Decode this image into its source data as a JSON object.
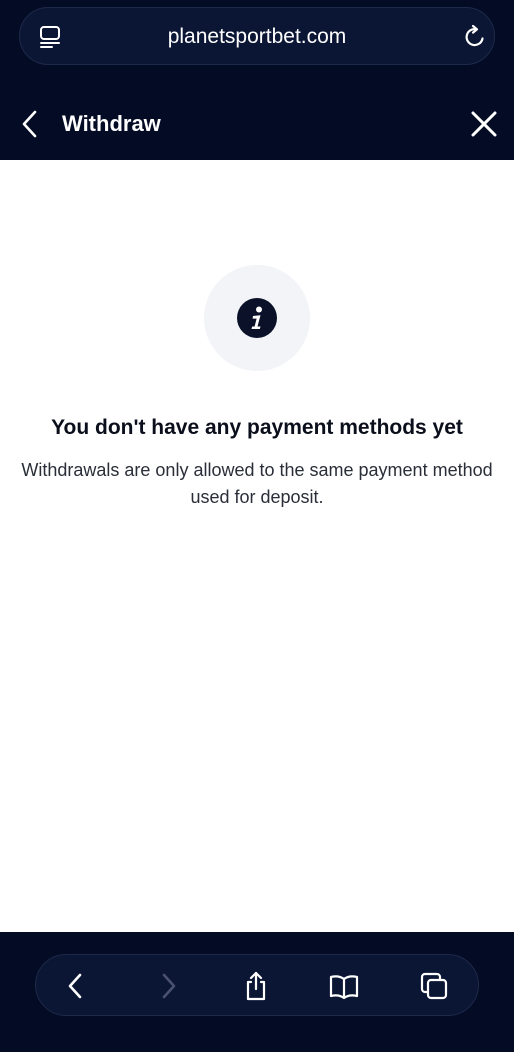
{
  "browser": {
    "url": "planetsportbet.com"
  },
  "header": {
    "title": "Withdraw"
  },
  "empty_state": {
    "title": "You don't have any payment methods yet",
    "description": "Withdrawals are only allowed to the same payment method used for deposit."
  },
  "toolbar": {
    "icons": [
      "back-icon",
      "forward-icon",
      "share-icon",
      "bookmarks-icon",
      "tabs-icon"
    ]
  },
  "colors": {
    "bar_background": "#040b24",
    "pill_background": "#0b1634",
    "icon_disabled": "#4a5270",
    "info_circle": "#f3f4f7",
    "info_icon": "#0a1128"
  }
}
